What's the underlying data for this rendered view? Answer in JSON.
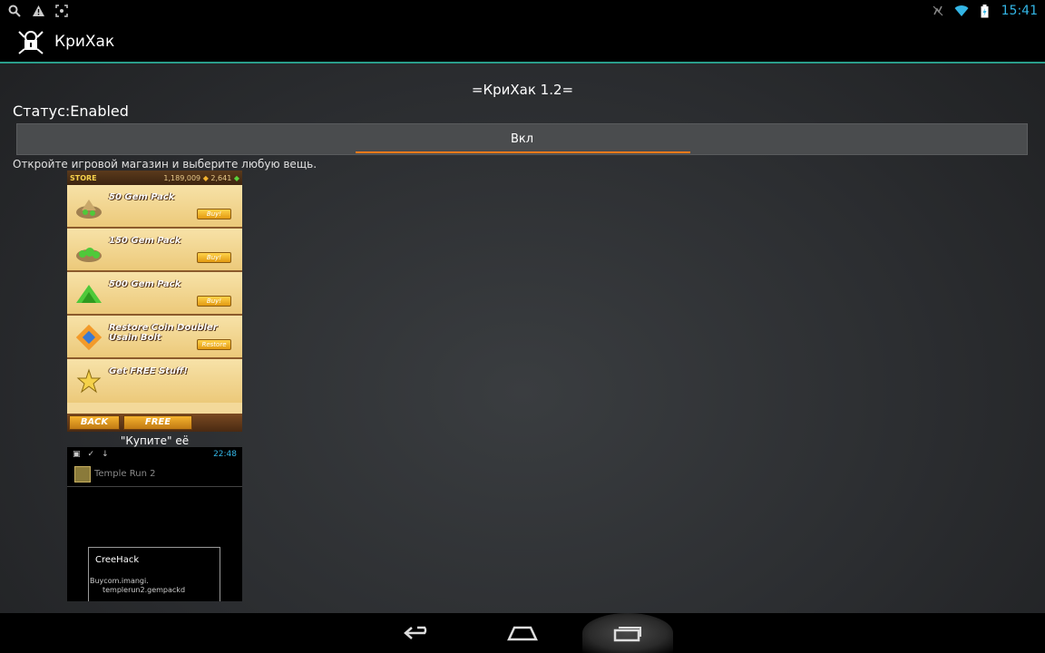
{
  "status_bar": {
    "time": "15:41"
  },
  "action_bar": {
    "title": "КриХак"
  },
  "main": {
    "heading": "=КриХак 1.2=",
    "status": "Статус:Enabled",
    "toggle_label": "Вкл",
    "instruction": "Откройте игровой магазин и выберите любую вещь.",
    "caption": "\"Купите\" её"
  },
  "screenshot_store": {
    "title": "STORE",
    "coins": "1,189,009",
    "gems": "2,641",
    "items": [
      {
        "label": "50 Gem Pack",
        "button": "Buy!"
      },
      {
        "label": "150 Gem Pack",
        "button": "Buy!"
      },
      {
        "label": "500 Gem Pack",
        "button": "Buy!"
      },
      {
        "label": "Restore Coin Doubler Usain Bolt",
        "button": "Restore"
      },
      {
        "label": "Get FREE Stuff!",
        "button": ""
      }
    ],
    "back_label": "BACK",
    "free_label": "FREE"
  },
  "screenshot_dialog": {
    "time": "22:48",
    "app_name": "Temple Run 2",
    "dialog_title": "CreeHack",
    "dialog_line1": "Buycom.imangi.",
    "dialog_line2": "templerun2.gempackd"
  },
  "colors": {
    "accent_time": "#33b5e5",
    "actionbar_underline": "#2a9d8a",
    "toggle_indicator": "#ff7a1a"
  }
}
